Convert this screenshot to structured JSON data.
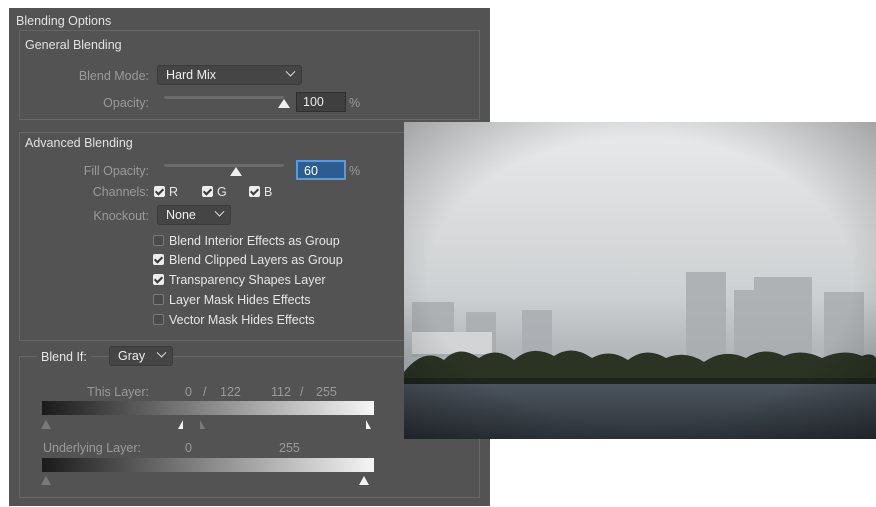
{
  "dialog": {
    "title": "Blending Options",
    "general": {
      "title": "General Blending",
      "blend_mode_label": "Blend Mode:",
      "blend_mode_value": "Hard Mix",
      "opacity_label": "Opacity:",
      "opacity_value": "100",
      "opacity_percent": 100,
      "percent_sign": "%"
    },
    "advanced": {
      "title": "Advanced Blending",
      "fill_opacity_label": "Fill Opacity:",
      "fill_opacity_value": "60",
      "fill_opacity_percent": 60,
      "percent_sign": "%",
      "channels_label": "Channels:",
      "channels": [
        {
          "label": "R",
          "checked": true
        },
        {
          "label": "G",
          "checked": true
        },
        {
          "label": "B",
          "checked": true
        }
      ],
      "knockout_label": "Knockout:",
      "knockout_value": "None",
      "options": [
        {
          "label": "Blend Interior Effects as Group",
          "checked": false
        },
        {
          "label": "Blend Clipped Layers as Group",
          "checked": true
        },
        {
          "label": "Transparency Shapes Layer",
          "checked": true
        },
        {
          "label": "Layer Mask Hides Effects",
          "checked": false
        },
        {
          "label": "Vector Mask Hides Effects",
          "checked": false
        }
      ]
    },
    "blend_if": {
      "label": "Blend If:",
      "value": "Gray",
      "this_layer": {
        "label": "This Layer:",
        "low_a": "0",
        "slash1": "/",
        "low_b": "122",
        "high_a": "112",
        "slash2": "/",
        "high_b": "255"
      },
      "underlying_layer": {
        "label": "Underlying Layer:",
        "low": "0",
        "high": "255"
      }
    }
  },
  "colors": {
    "panel_bg": "#535353",
    "field_active": "#2c5c91"
  }
}
